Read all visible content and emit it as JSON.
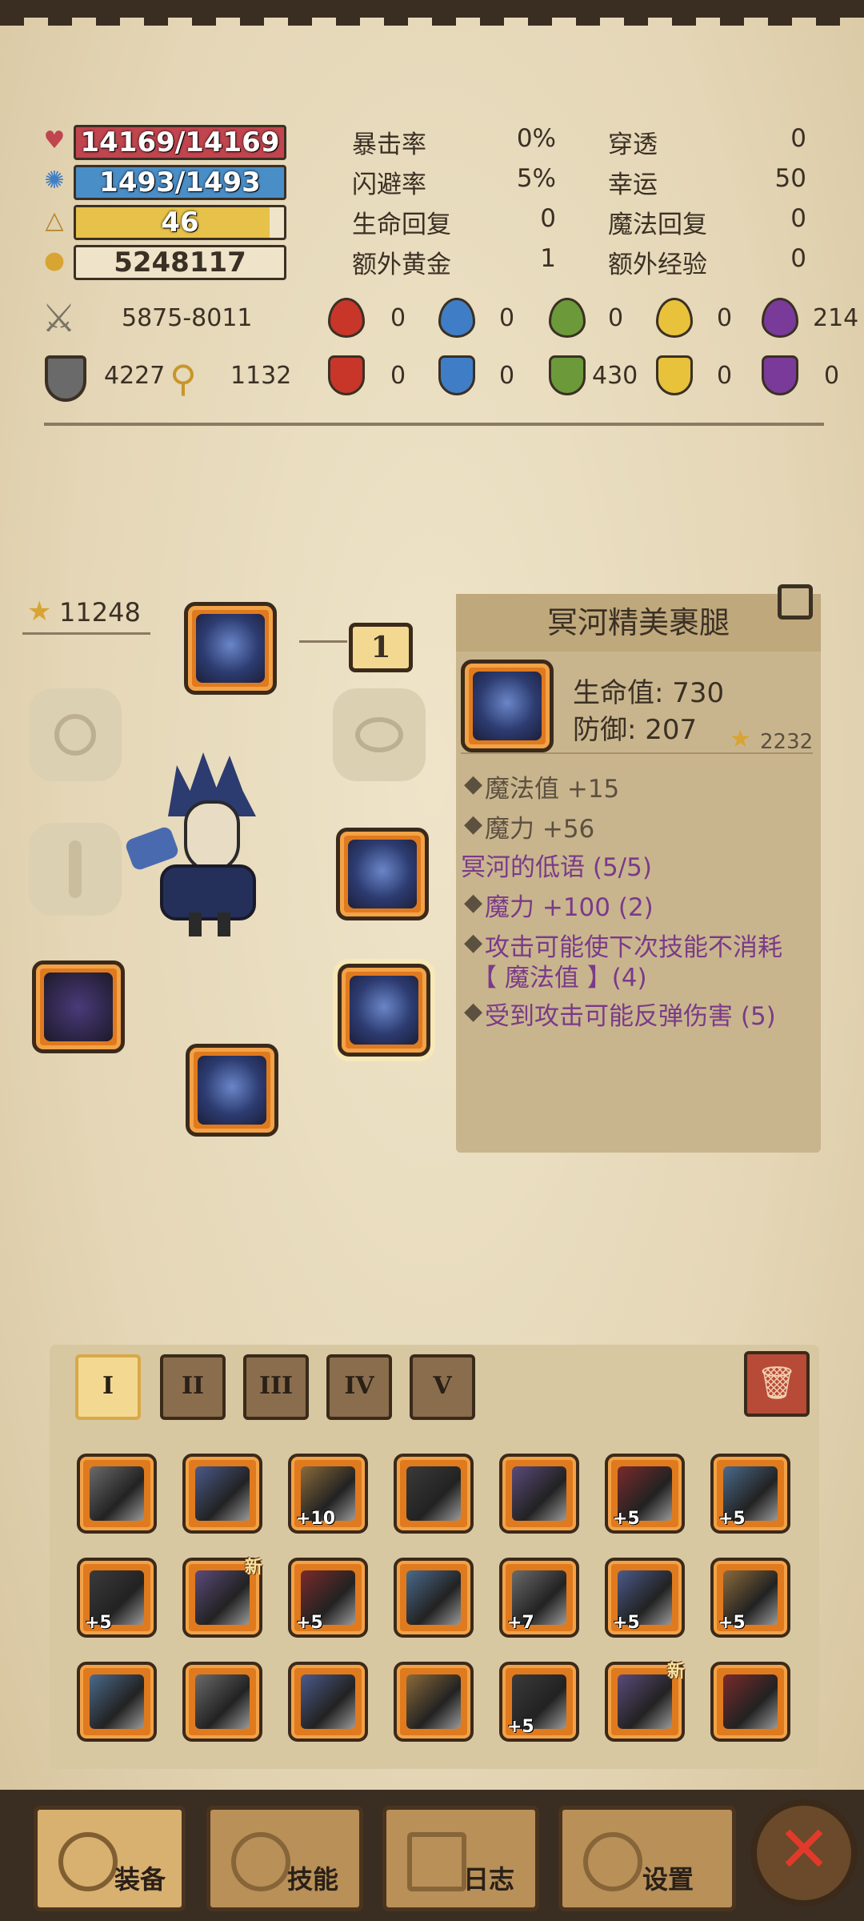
{
  "stats": {
    "hp": "14169/14169",
    "mp": "1493/1493",
    "level": "46",
    "gold": "5248117",
    "level_fill_percent": 93,
    "hp_color": "#c0454e",
    "mp_color": "#4a8ec8",
    "level_color": "#e6c24a"
  },
  "attributes": [
    {
      "label": "暴击率",
      "value": "0%"
    },
    {
      "label": "闪避率",
      "value": "5%"
    },
    {
      "label": "生命回复",
      "value": "0"
    },
    {
      "label": "额外黄金",
      "value": "1"
    },
    {
      "label": "穿透",
      "value": "0"
    },
    {
      "label": "幸运",
      "value": "50"
    },
    {
      "label": "魔法回复",
      "value": "0"
    },
    {
      "label": "额外经验",
      "value": "0"
    }
  ],
  "combat": {
    "attack": "5875-8011",
    "defense": "4227",
    "magic": "1132",
    "attack_elements": [
      "0",
      "0",
      "0",
      "0",
      "214"
    ],
    "resist_elements": [
      "0",
      "0",
      "430",
      "0",
      "0"
    ],
    "element_colors": [
      "#c8362a",
      "#3f7ec6",
      "#6c9a3a",
      "#e8c23a",
      "#7a3a9a"
    ]
  },
  "equipment": {
    "total_score": "11248",
    "lock_count": "1"
  },
  "item_detail": {
    "name": "冥河精美裹腿",
    "hp": "生命值: 730",
    "defense": "防御: 207",
    "score": "2232",
    "bonus1": "魔法值 +15",
    "bonus2": "魔力 +56",
    "set_name": "冥河的低语 (5/5)",
    "set1": "魔力 +100 (2)",
    "set2": "攻击可能使下次技能不消耗",
    "set2b": "【 魔法值 】(4)",
    "set3": "受到攻击可能反弹伤害 (5)"
  },
  "inventory": {
    "tabs": [
      "I",
      "II",
      "III",
      "IV",
      "V"
    ],
    "rows": [
      [
        {
          "lvl": ""
        },
        {
          "lvl": ""
        },
        {
          "lvl": "+10"
        },
        {
          "lvl": ""
        },
        {
          "lvl": ""
        },
        {
          "lvl": "+5"
        },
        {
          "lvl": "+5"
        }
      ],
      [
        {
          "lvl": "+5"
        },
        {
          "lvl": "",
          "new": "新"
        },
        {
          "lvl": "+5"
        },
        {
          "lvl": ""
        },
        {
          "lvl": "+7"
        },
        {
          "lvl": "+5"
        },
        {
          "lvl": "+5"
        }
      ],
      [
        {
          "lvl": ""
        },
        {
          "lvl": ""
        },
        {
          "lvl": ""
        },
        {
          "lvl": ""
        },
        {
          "lvl": "+5"
        },
        {
          "lvl": "",
          "new": "新"
        },
        {
          "lvl": ""
        }
      ]
    ]
  },
  "nav": {
    "equip": "装备",
    "skills": "技能",
    "log": "日志",
    "settings": "设置"
  }
}
